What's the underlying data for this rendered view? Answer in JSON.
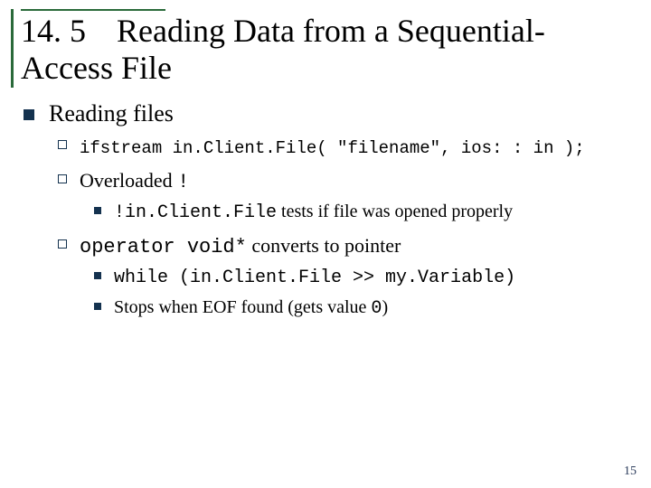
{
  "title": {
    "section_number": "14. 5",
    "text": "Reading Data from a Sequential-Access File"
  },
  "bullets": {
    "l1_reading_files": "Reading files",
    "l2_ifstream_code": "ifstream in.Client.File( \"filename\", ios: : in );",
    "l2_overloaded_prefix": "Overloaded ",
    "l2_overloaded_op": "!",
    "l3_bang_code": "!in.Client.File",
    "l3_bang_rest": " tests if file was opened properly",
    "l2_opvoid_code": "operator void*",
    "l2_opvoid_rest": " converts to pointer",
    "l3_while_code": "while (in.Client.File >> my.Variable)",
    "l3_stops_prefix": "Stops when EOF found (gets value ",
    "l3_stops_zero": "0",
    "l3_stops_suffix": ")"
  },
  "page_number": "15"
}
